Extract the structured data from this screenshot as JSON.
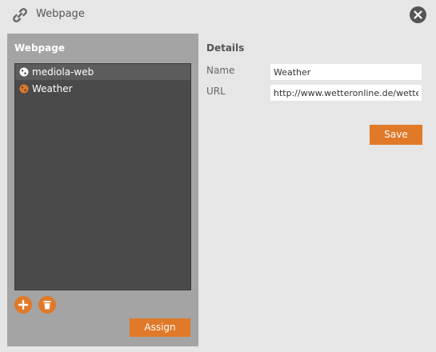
{
  "window": {
    "title": "Webpage",
    "title_icon": "link-icon",
    "close_icon": "close-icon"
  },
  "left_panel": {
    "heading": "Webpage",
    "items": [
      {
        "label": "mediola-web",
        "icon": "globe-icon",
        "icon_color": "#ffffff",
        "selected": true
      },
      {
        "label": "Weather",
        "icon": "globe-icon",
        "icon_color": "#e07928",
        "selected": false
      }
    ],
    "add_icon": "plus-icon",
    "delete_icon": "trash-icon",
    "assign_label": "Assign"
  },
  "details": {
    "title": "Details",
    "name_label": "Name",
    "name_value": "Weather",
    "url_label": "URL",
    "url_value": "http://www.wetteronline.de/wetter",
    "save_label": "Save"
  },
  "colors": {
    "accent": "#e07928",
    "panel_bg": "#a4a4a4",
    "list_bg": "#4a4a4a",
    "page_bg": "#e6e6e6"
  }
}
